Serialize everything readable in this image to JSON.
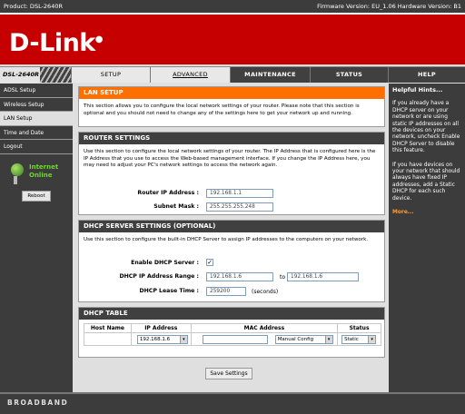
{
  "topbar": {
    "product": "Product: DSL-2640R",
    "firmware": "Firmware Version: EU_1.06 Hardware Version: B1"
  },
  "brand": {
    "logo": "D-Link",
    "model": "DSL-2640R"
  },
  "tabs": [
    {
      "label": "SETUP"
    },
    {
      "label": "ADVANCED"
    },
    {
      "label": "MAINTENANCE"
    },
    {
      "label": "STATUS"
    },
    {
      "label": "HELP"
    }
  ],
  "sidebar": {
    "items": [
      {
        "label": "ADSL Setup"
      },
      {
        "label": "Wireless Setup"
      },
      {
        "label": "LAN Setup"
      },
      {
        "label": "Time and Date"
      },
      {
        "label": "Logout"
      }
    ],
    "internet_label_1": "Internet",
    "internet_label_2": "Online",
    "reboot_label": "Reboot"
  },
  "lan_setup": {
    "title": "LAN SETUP",
    "description": "This section allows you to configure the local network settings of your router. Please note that this section is optional and you should not need to change any of the settings here to get your network up and running."
  },
  "router_settings": {
    "title": "ROUTER SETTINGS",
    "description": "Use this section to configure the local network settings of your router. The IP Address that is configured here is the IP Address that you use to access the Web-based management interface. If you change the IP Address here, you may need to adjust your PC's network settings to access the network again.",
    "ip_label": "Router IP Address :",
    "ip_value": "192.168.1.1",
    "mask_label": "Subnet Mask :",
    "mask_value": "255.255.255.248"
  },
  "dhcp_server": {
    "title": "DHCP SERVER SETTINGS (OPTIONAL)",
    "description": "Use this section to configure the built-in DHCP Server to assign IP addresses to the computers on your network.",
    "enable_label": "Enable DHCP Server :",
    "enable_checked": "✓",
    "range_label": "DHCP IP Address Range :",
    "range_start": "192.168.1.6",
    "range_to": "to",
    "range_end": "192.168.1.6",
    "lease_label": "DHCP Lease Time :",
    "lease_value": "259200",
    "lease_unit": "(seconds)"
  },
  "dhcp_table": {
    "title": "DHCP TABLE",
    "headers": [
      "Host Name",
      "IP Address",
      "MAC Address",
      "Status"
    ],
    "row": {
      "ip": "192.168.1.6",
      "mac": "",
      "type": "Manual Config",
      "status": "Static"
    }
  },
  "save_label": "Save Settings",
  "help": {
    "title": "Helpful Hints...",
    "p1": "If you already have a DHCP server on your network or are using static IP addresses on all the devices on your network, uncheck Enable DHCP Server to disable this feature.",
    "p2": "If you have devices on your network that should always have fixed IP addresses, add a Static DHCP for each such device.",
    "more": "More..."
  },
  "footer": "BROADBAND"
}
